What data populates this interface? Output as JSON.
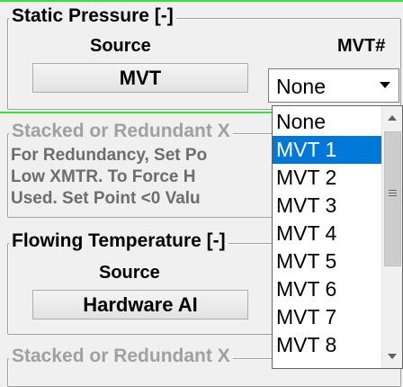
{
  "static_pressure": {
    "legend": "Static Pressure [-]",
    "source_label": "Source",
    "mvt_label": "MVT#",
    "source_button": "MVT",
    "mvt_combo_value": "None"
  },
  "stacked_redundant_1": {
    "legend": "Stacked or Redundant X",
    "line1": "For Redundancy, Set Po",
    "line2": "Low XMTR.  To Force H",
    "line3": "Used. Set Point <0 Valu"
  },
  "flowing_temperature": {
    "legend": "Flowing Temperature [-]",
    "source_label": "Source",
    "source_button": "Hardware AI"
  },
  "stacked_redundant_2": {
    "legend": "Stacked or Redundant X"
  },
  "dropdown": {
    "items": [
      "None",
      "MVT 1",
      "MVT 2",
      "MVT 3",
      "MVT 4",
      "MVT 5",
      "MVT 6",
      "MVT 7",
      "MVT 8"
    ],
    "selected": "MVT 1"
  },
  "icons": {
    "combo_arrow": "chevron-down-icon",
    "scroll_up": "scroll-up-icon",
    "scroll_down": "scroll-down-icon",
    "scroll_grip": "scroll-grip-icon"
  },
  "colors": {
    "selection": "#0078d7",
    "green_line": "#33e633"
  }
}
